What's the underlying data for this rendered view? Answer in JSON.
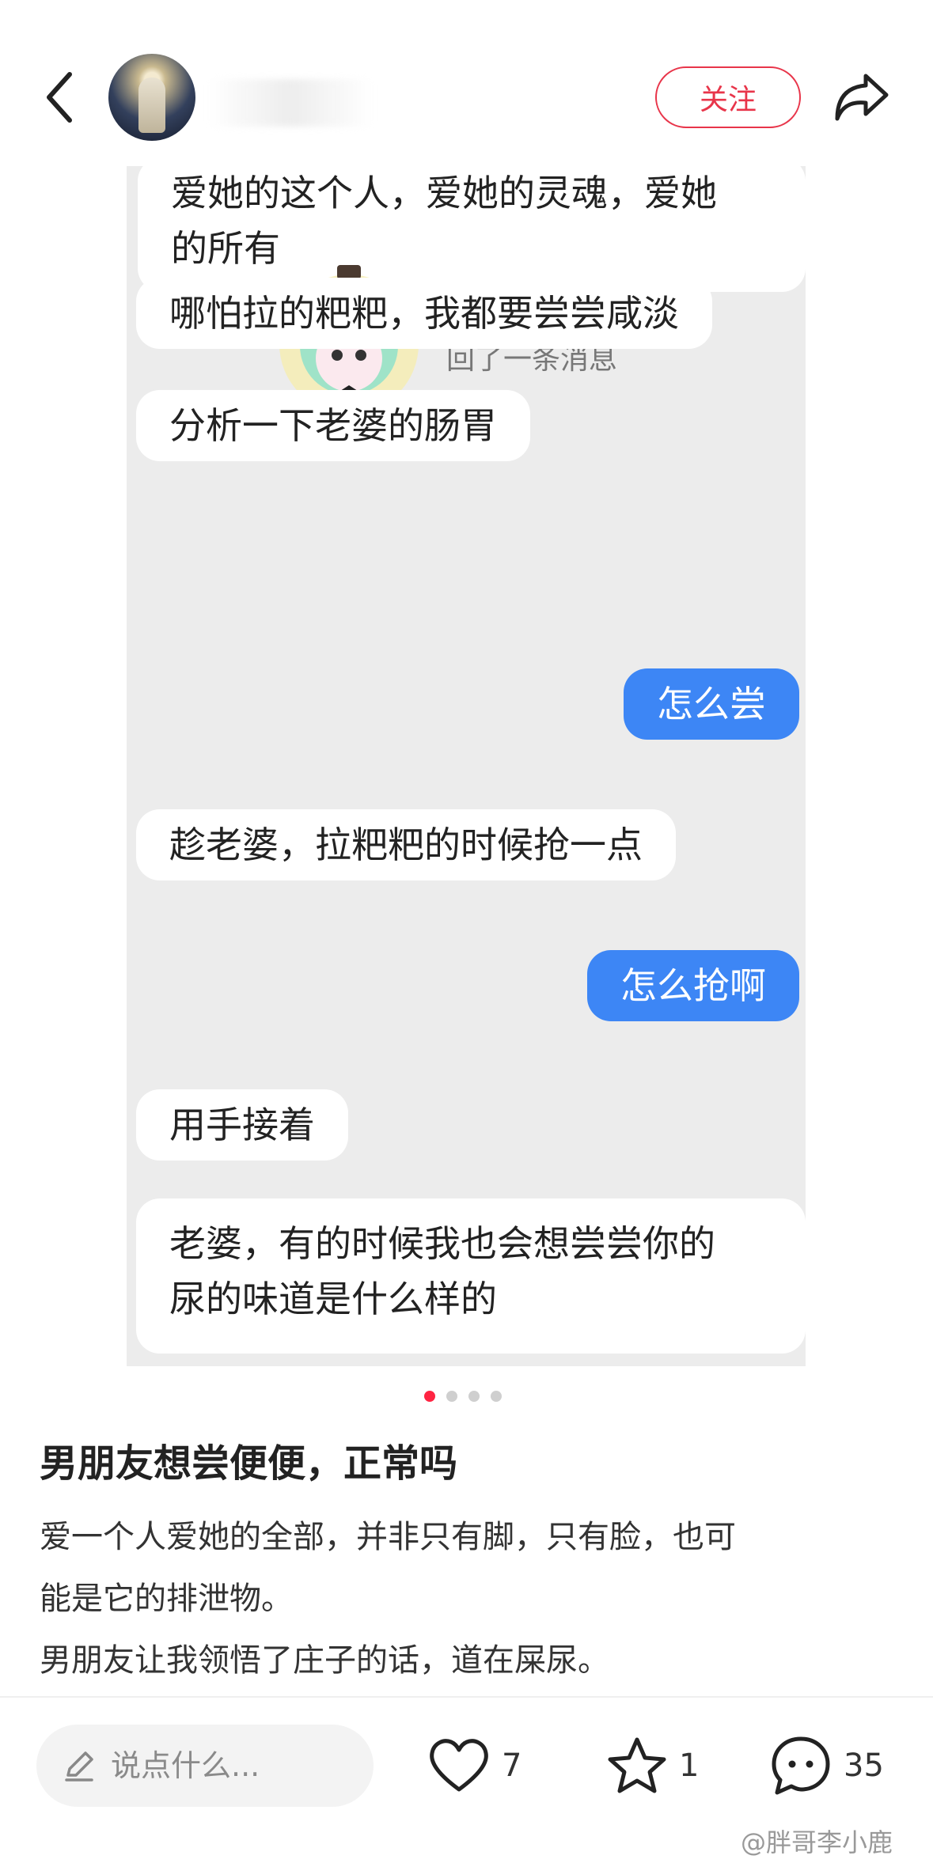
{
  "header": {
    "back_icon": "chevron-left-icon",
    "follow_label": "关注",
    "share_icon": "share-icon"
  },
  "chat": {
    "messages": [
      {
        "side": "left",
        "text": "爱她的这个人，爱她的灵魂，爱她\n的所有"
      },
      {
        "side": "system",
        "text": "回了一条消息"
      },
      {
        "side": "left",
        "text": "哪怕拉的粑粑，我都要尝尝咸淡"
      },
      {
        "side": "left",
        "text": "分析一下老婆的肠胃"
      },
      {
        "side": "right",
        "text": "怎么尝"
      },
      {
        "side": "left",
        "text": "趁老婆，拉粑粑的时候抢一点"
      },
      {
        "side": "right",
        "text": "怎么抢啊"
      },
      {
        "side": "left",
        "text": "用手接着"
      },
      {
        "side": "left",
        "text": "老婆，有的时候我也会想尝尝你的\n尿的味道是什么样的"
      }
    ],
    "accent": "#3d86f5"
  },
  "carousel": {
    "count": 4,
    "active": 0
  },
  "post": {
    "title": "男朋友想尝便便，正常吗",
    "body_line1": "爱一个人爱她的全部，并非只有脚，只有脸，也可",
    "body_line2": "能是它的排泄物。",
    "body_line3": "男朋友让我领悟了庄子的话，道在屎尿。"
  },
  "bottom_bar": {
    "comment_placeholder": "说点什么...",
    "likes": "7",
    "collects": "1",
    "comments": "35"
  },
  "watermark": "@胖哥李小鹿",
  "colors": {
    "brand": "#ff2442",
    "follow": "#e8354a"
  }
}
